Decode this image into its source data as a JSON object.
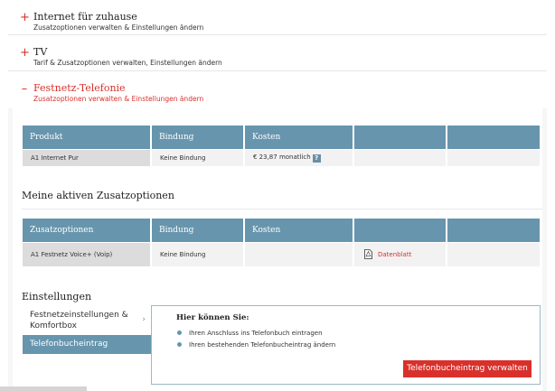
{
  "accordion": [
    {
      "sign": "+",
      "title": "Internet für zuhause",
      "subtitle": "Zusatzoptionen verwalten & Einstellungen ändern"
    },
    {
      "sign": "+",
      "title": "TV",
      "subtitle": "Tarif & Zusatzoptionen verwalten, Einstellungen ändern"
    },
    {
      "sign": "–",
      "title": "Festnetz-Telefonie",
      "subtitle": "Zusatzoptionen verwalten & Einstellungen ändern"
    }
  ],
  "product_table": {
    "headers": [
      "Produkt",
      "Bindung",
      "Kosten",
      "",
      ""
    ],
    "row": {
      "produkt": "A1 Internet Pur",
      "bindung": "Keine Bindung",
      "kosten": "€ 23,87 monatlich",
      "help": "?"
    }
  },
  "addons": {
    "heading": "Meine aktiven Zusatzoptionen",
    "headers": [
      "Zusatzoptionen",
      "Bindung",
      "Kosten",
      "",
      ""
    ],
    "row": {
      "name": "A1 Festnetz Voice+ (Voip)",
      "bindung": "Keine Bindung",
      "kosten": "",
      "link": "Datenblatt"
    }
  },
  "settings": {
    "heading": "Einstellungen",
    "nav": [
      {
        "label": "Festnetzeinstellungen & Komfortbox",
        "chevron": "›"
      },
      {
        "label": "Telefonbucheintrag"
      }
    ],
    "panel": {
      "heading": "Hier können Sie:",
      "bullets": [
        "Ihren Anschluss ins Telefonbuch eintragen",
        "Ihren bestehenden Telefonbucheintrag ändern"
      ],
      "button": "Telefonbucheintrag verwalten"
    }
  },
  "colors": {
    "accent": "#d9302b",
    "table_header": "#6795ad"
  }
}
